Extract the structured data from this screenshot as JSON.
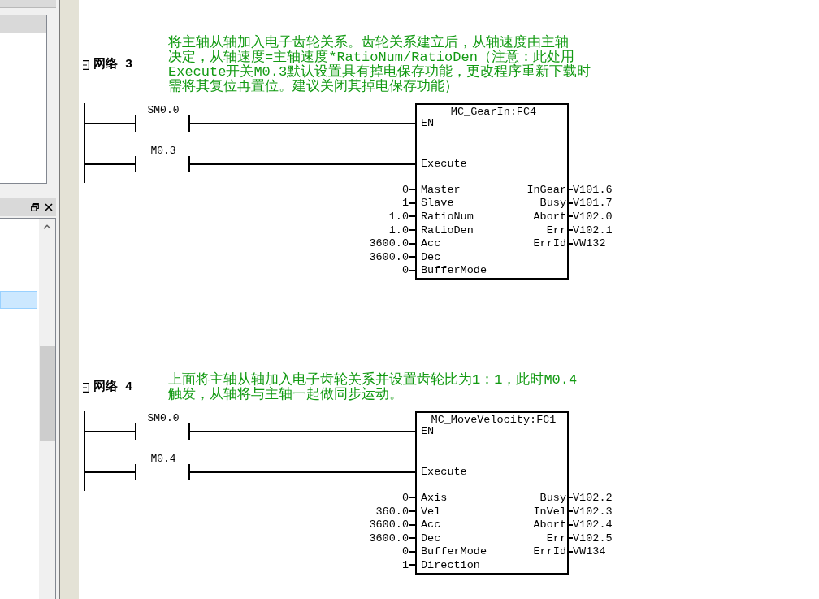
{
  "side_panel": {
    "list_rows": [
      {
        "selected": true
      }
    ]
  },
  "networks": [
    {
      "label": "网络 3",
      "expanded": true,
      "comment_lines": [
        "将主轴从轴加入电子齿轮关系。齿轮关系建立后，从轴速度由主轴",
        "决定，从轴速度=主轴速度*RatioNum/RatioDen（注意：此处用",
        "Execute开关M0.3默认设置具有掉电保存功能，更改程序重新下载时",
        "需将其复位再置位。建议关闭其掉电保存功能）"
      ],
      "rungs": [
        {
          "contact": "SM0.0",
          "input": "EN"
        },
        {
          "contact": "M0.3",
          "input": "Execute"
        }
      ],
      "block": {
        "title": "MC_GearIn:FC4",
        "inputs": [
          {
            "value": "0",
            "pin": "Master"
          },
          {
            "value": "1",
            "pin": "Slave"
          },
          {
            "value": "1.0",
            "pin": "RatioNum"
          },
          {
            "value": "1.0",
            "pin": "RatioDen"
          },
          {
            "value": "3600.0",
            "pin": "Acc"
          },
          {
            "value": "3600.0",
            "pin": "Dec"
          },
          {
            "value": "0",
            "pin": "BufferMode"
          }
        ],
        "outputs": [
          {
            "pin": "InGear",
            "value": "V101.6"
          },
          {
            "pin": "Busy",
            "value": "V101.7"
          },
          {
            "pin": "Abort",
            "value": "V102.0"
          },
          {
            "pin": "Err",
            "value": "V102.1"
          },
          {
            "pin": "ErrId",
            "value": "VW132"
          }
        ]
      }
    },
    {
      "label": "网络 4",
      "expanded": true,
      "comment_lines": [
        "上面将主轴从轴加入电子齿轮关系并设置齿轮比为1：1，此时M0.4",
        "触发，从轴将与主轴一起做同步运动。"
      ],
      "rungs": [
        {
          "contact": "SM0.0",
          "input": "EN"
        },
        {
          "contact": "M0.4",
          "input": "Execute"
        }
      ],
      "block": {
        "title": "MC_MoveVelocity:FC1",
        "inputs": [
          {
            "value": "0",
            "pin": "Axis"
          },
          {
            "value": "360.0",
            "pin": "Vel"
          },
          {
            "value": "3600.0",
            "pin": "Acc"
          },
          {
            "value": "3600.0",
            "pin": "Dec"
          },
          {
            "value": "0",
            "pin": "BufferMode"
          },
          {
            "value": "1",
            "pin": "Direction"
          }
        ],
        "outputs": [
          {
            "pin": "Busy",
            "value": "V102.2"
          },
          {
            "pin": "InVel",
            "value": "V102.3"
          },
          {
            "pin": "Abort",
            "value": "V102.4"
          },
          {
            "pin": "Err",
            "value": "V102.5"
          },
          {
            "pin": "ErrId",
            "value": "VW134"
          }
        ]
      }
    }
  ]
}
